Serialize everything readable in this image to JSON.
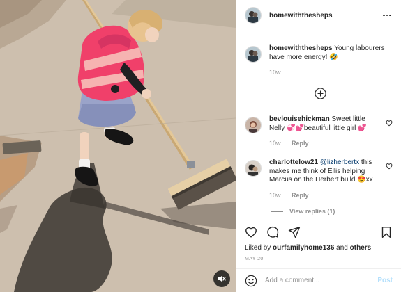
{
  "post": {
    "author": "homewiththesheps",
    "more_icon": "more-horizontal-icon"
  },
  "caption": {
    "username": "homewiththesheps",
    "text": "Young labourers have more energy! 🤣",
    "age": "10w"
  },
  "comments": [
    {
      "username": "bevlouisehickman",
      "text": "Sweet little Nelly 💞💕beautiful little girl 💕",
      "age": "10w",
      "reply_label": "Reply"
    },
    {
      "username": "charlottelow21",
      "mention": "@lizherbertx",
      "text": " this makes me think of Ellis helping Marcus on the Herbert build 😍xx",
      "age": "10w",
      "reply_label": "Reply"
    }
  ],
  "view_replies": "View replies (1)",
  "likes": {
    "prefix": "Liked by ",
    "user": "ourfamilyhome136",
    "middle": " and ",
    "others": "others"
  },
  "date": "MAY 20",
  "composer": {
    "placeholder": "Add a comment...",
    "post_label": "Post"
  },
  "colors": {
    "accent_blue_disabled": "#b2dffc",
    "mention": "#00376b",
    "secondary_text": "#8e8e8e",
    "vest": "#f0406a"
  }
}
